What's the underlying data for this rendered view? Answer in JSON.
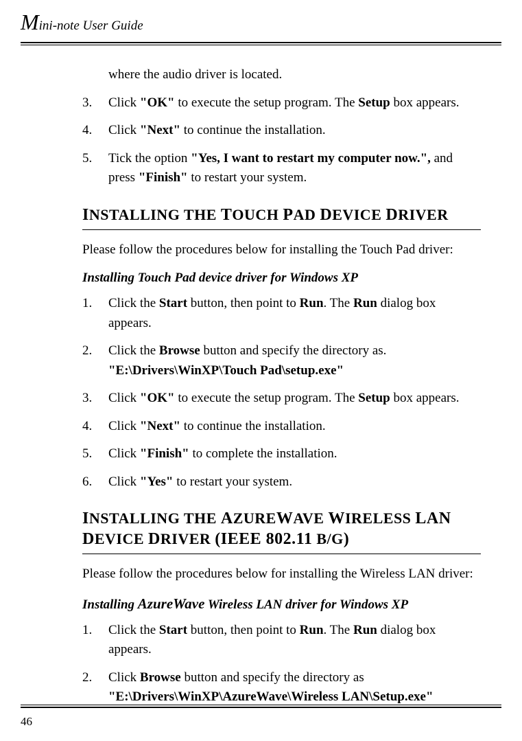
{
  "header": {
    "title_rest": "ini-note User Guide"
  },
  "intro_para": "where the audio driver is located.",
  "list1": {
    "i3": {
      "num": "3.",
      "t1": "Click ",
      "b1": "\"OK\"",
      "t2": " to execute the setup program. The ",
      "b2": "Setup",
      "t3": " box appears."
    },
    "i4": {
      "num": "4.",
      "t1": "Click ",
      "b1": "\"Next\"",
      "t2": " to continue the installation."
    },
    "i5": {
      "num": "5.",
      "t1": "Tick the option ",
      "b1": "\"Yes, I want to restart my computer now.\",",
      "t2": " and press ",
      "b2": "\"Finish\"",
      "t3": " to restart your system."
    }
  },
  "sec_touchpad": {
    "heading_html": "Installing the Touch Pad Device Driver",
    "para": "Please follow the procedures below for installing the Touch Pad driver:",
    "sub": "Installing Touch Pad device driver for Windows XP",
    "items": {
      "i1": {
        "num": "1.",
        "t1": "Click the ",
        "b1": "Start",
        "t2": " button, then point to ",
        "b2": "Run",
        "t3": ". The ",
        "b3": "Run",
        "t4": " dialog box appears."
      },
      "i2": {
        "num": "2.",
        "t1": "Click the ",
        "b1": "Browse",
        "t2": " button and specify the directory as.",
        "path": "\"E:\\Drivers\\WinXP\\Touch Pad\\setup.exe\""
      },
      "i3": {
        "num": "3.",
        "t1": "Click ",
        "b1": "\"OK\"",
        "t2": " to execute the setup program. The ",
        "b2": "Setup",
        "t3": " box appears."
      },
      "i4": {
        "num": "4.",
        "t1": "Click ",
        "b1": "\"Next\"",
        "t2": " to continue the installation."
      },
      "i5": {
        "num": "5.",
        "t1": "Click ",
        "b1": "\"Finish\"",
        "t2": " to complete the installation."
      },
      "i6": {
        "num": "6.",
        "t1": "Click ",
        "b1": "\"Yes\"",
        "t2": " to restart your system."
      }
    }
  },
  "sec_wlan": {
    "heading": "Installing the AzureWave Wireless LAN Device Driver (IEEE 802.11 b/g)",
    "para": "Please follow the procedures below for installing the Wireless LAN driver:",
    "sub_pre": "Installing ",
    "sub_mid": "AzureWave",
    "sub_post": " Wireless LAN driver for Windows XP",
    "items": {
      "i1": {
        "num": "1.",
        "t1": "Click the ",
        "b1": "Start",
        "t2": " button, then point to ",
        "b2": "Run",
        "t3": ". The ",
        "b3": "Run",
        "t4": " dialog box appears."
      },
      "i2": {
        "num": "2.",
        "t1": "Click ",
        "b1": "Browse",
        "t2": " button and specify the directory as",
        "path": "\"E:\\Drivers\\WinXP\\AzureWave\\Wireless LAN\\Setup.exe\""
      }
    }
  },
  "page_number": "46"
}
